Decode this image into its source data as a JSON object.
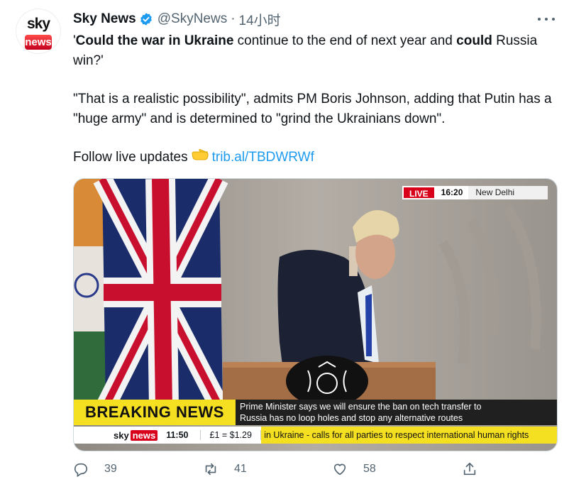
{
  "account": {
    "avatar_top": "sky",
    "avatar_bottom": "news",
    "name": "Sky News",
    "handle": "@SkyNews",
    "separator": "·",
    "time": "14小时"
  },
  "tweet": {
    "line1_q_open": "'",
    "line1_b1": "Could the war in Ukraine",
    "line1_mid": " continue to the end of next year and ",
    "line1_b2": "could",
    "line1_end": " Russia win?'",
    "para2": "\"That is a realistic possibility\", admits PM Boris Johnson, adding that Putin has a \"huge army\" and is determined to \"grind the Ukrainians down\".",
    "follow_text": "Follow live updates",
    "emoji": "👉",
    "link": "trib.al/TBDWRWf"
  },
  "video": {
    "live_label": "LIVE",
    "clock": "16:20",
    "location": "New Delhi",
    "breaking_label": "BREAKING NEWS",
    "headline_line1": "Prime Minister says we will ensure the ban on tech transfer to",
    "headline_line2": "Russia has no loop holes and stop any alternative routes",
    "ticker_logo_sky": "sky",
    "ticker_logo_news": "news",
    "ticker_time": "11:50",
    "ticker_rate": "£1 = $1.29",
    "ticker_crawl": "in Ukraine - calls for all parties to respect international human rights"
  },
  "actions": {
    "reply_count": "39",
    "retweet_count": "41",
    "like_count": "58"
  },
  "colors": {
    "link": "#1d9bf0",
    "secondary": "#536471",
    "verified": "#1d9bf0",
    "breaking": "#f5df21",
    "live_red": "#d9001b"
  },
  "icons": [
    "verified-badge-icon",
    "more-icon",
    "reply-icon",
    "retweet-icon",
    "like-icon",
    "share-icon",
    "pointing-hand-emoji"
  ]
}
